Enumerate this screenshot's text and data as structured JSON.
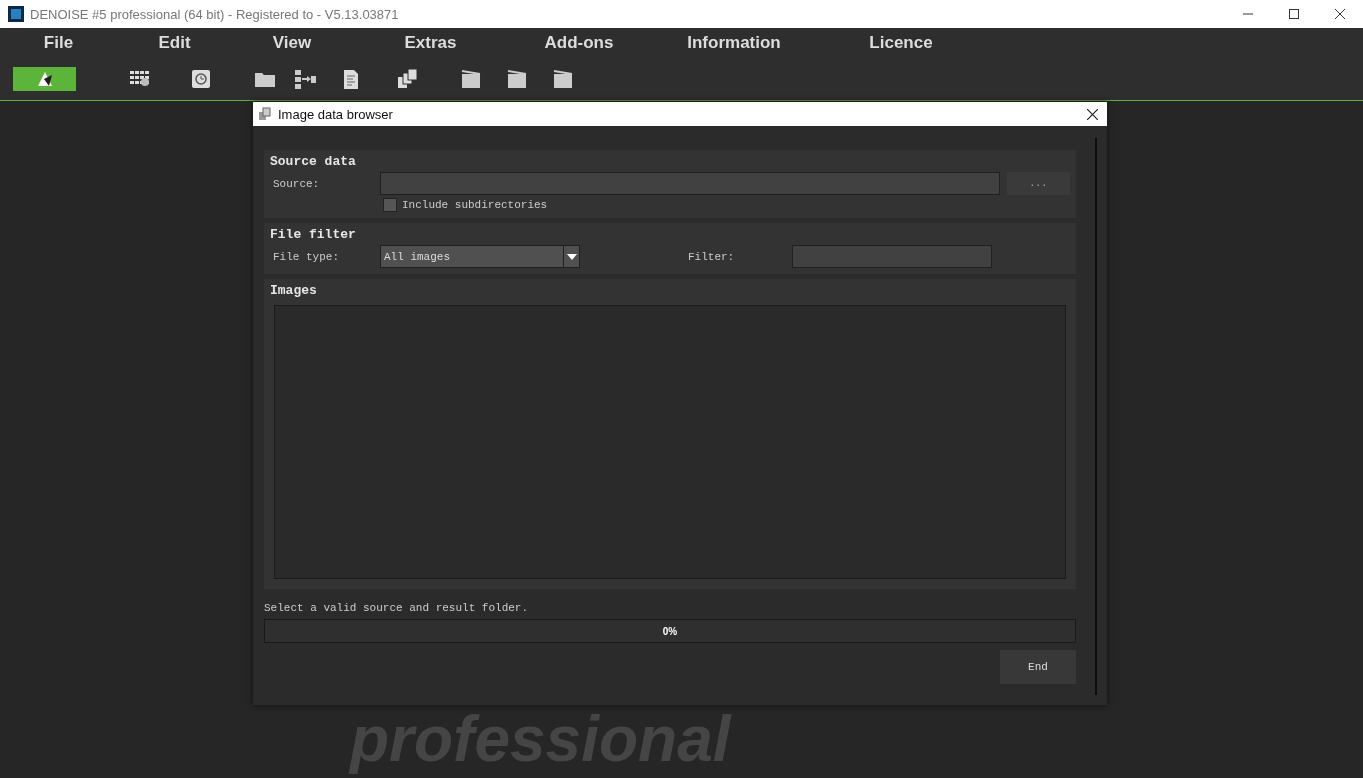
{
  "window": {
    "title": "DENOISE #5 professional (64 bit) - Registered to - V5.13.03871"
  },
  "menu": [
    "File",
    "Edit",
    "View",
    "Extras",
    "Add-ons",
    "Information",
    "Licence"
  ],
  "toolbar": [
    {
      "selected": true
    },
    {
      "selected": false
    },
    {
      "selected": false
    },
    {
      "selected": false
    },
    {
      "selected": false
    },
    {
      "selected": false
    },
    {
      "selected": false
    },
    {
      "selected": false
    },
    {
      "selected": false
    },
    {
      "selected": false
    }
  ],
  "background_logo": "professional",
  "dialog": {
    "title": "Image data browser",
    "source_data": {
      "title": "Source data",
      "source_label": "Source:",
      "browse_button": "...",
      "include_subdirectories": {
        "label": "Include subdirectories",
        "checked": false
      }
    },
    "file_filter": {
      "title": "File filter",
      "file_type_label": "File type:",
      "file_type_value": "All images",
      "filter_label": "Filter:"
    },
    "images": {
      "title": "Images"
    },
    "status": "Select a valid source and result folder.",
    "progress": {
      "level": 0,
      "reading": "0%"
    },
    "end_button": "End"
  }
}
